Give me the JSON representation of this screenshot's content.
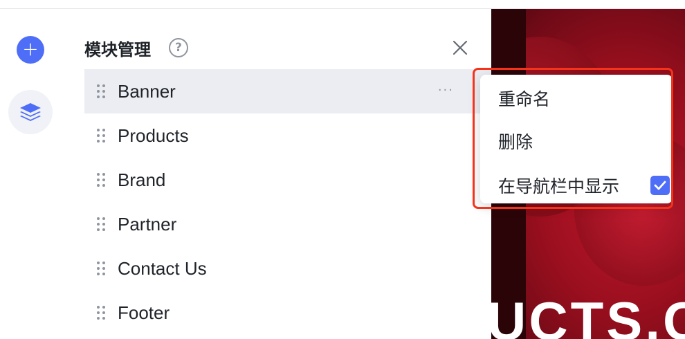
{
  "panel": {
    "title": "模块管理",
    "help_glyph": "?"
  },
  "rail": {
    "add_glyph": "+"
  },
  "modules": [
    {
      "label": "Banner",
      "active": true
    },
    {
      "label": "Products"
    },
    {
      "label": "Brand"
    },
    {
      "label": "Partner"
    },
    {
      "label": "Contact Us"
    },
    {
      "label": "Footer"
    }
  ],
  "item_more_glyph": "···",
  "context_menu": {
    "rename": "重命名",
    "delete": "删除",
    "show_in_nav": "在导航栏中显示",
    "show_in_nav_checked": true
  },
  "preview": {
    "visible_text": "UCTS.C"
  },
  "colors": {
    "accent": "#4f6ef7",
    "highlight": "#f5331b",
    "active_row": "#ebedf2"
  }
}
